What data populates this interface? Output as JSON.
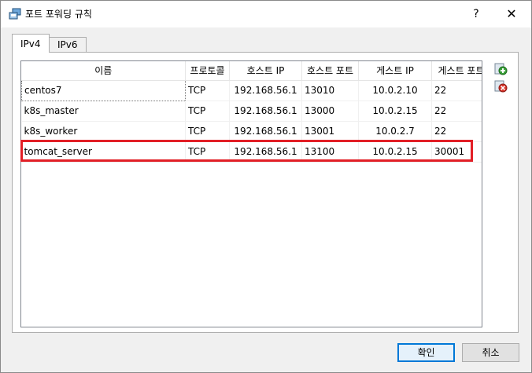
{
  "window": {
    "title": "포트 포워딩 규칙",
    "help_label": "?",
    "close_label": "✕"
  },
  "tabs": [
    {
      "label": "IPv4",
      "active": true
    },
    {
      "label": "IPv6",
      "active": false
    }
  ],
  "table": {
    "headers": [
      "이름",
      "프로토콜",
      "호스트 IP",
      "호스트 포트",
      "게스트 IP",
      "게스트 포트"
    ],
    "rows": [
      [
        "centos7",
        "TCP",
        "192.168.56.1",
        "13010",
        "10.0.2.10",
        "22"
      ],
      [
        "k8s_master",
        "TCP",
        "192.168.56.1",
        "13000",
        "10.0.2.15",
        "22"
      ],
      [
        "k8s_worker",
        "TCP",
        "192.168.56.1",
        "13001",
        "10.0.2.7",
        "22"
      ],
      [
        "tomcat_server",
        "TCP",
        "192.168.56.1",
        "13100",
        "10.0.2.15",
        "30001"
      ]
    ]
  },
  "icons": {
    "add": "add-rule-icon",
    "remove": "remove-rule-icon"
  },
  "colors": {
    "highlight": "#e21f26",
    "accent": "#0078d7"
  },
  "buttons": {
    "ok": "확인",
    "cancel": "취소"
  }
}
